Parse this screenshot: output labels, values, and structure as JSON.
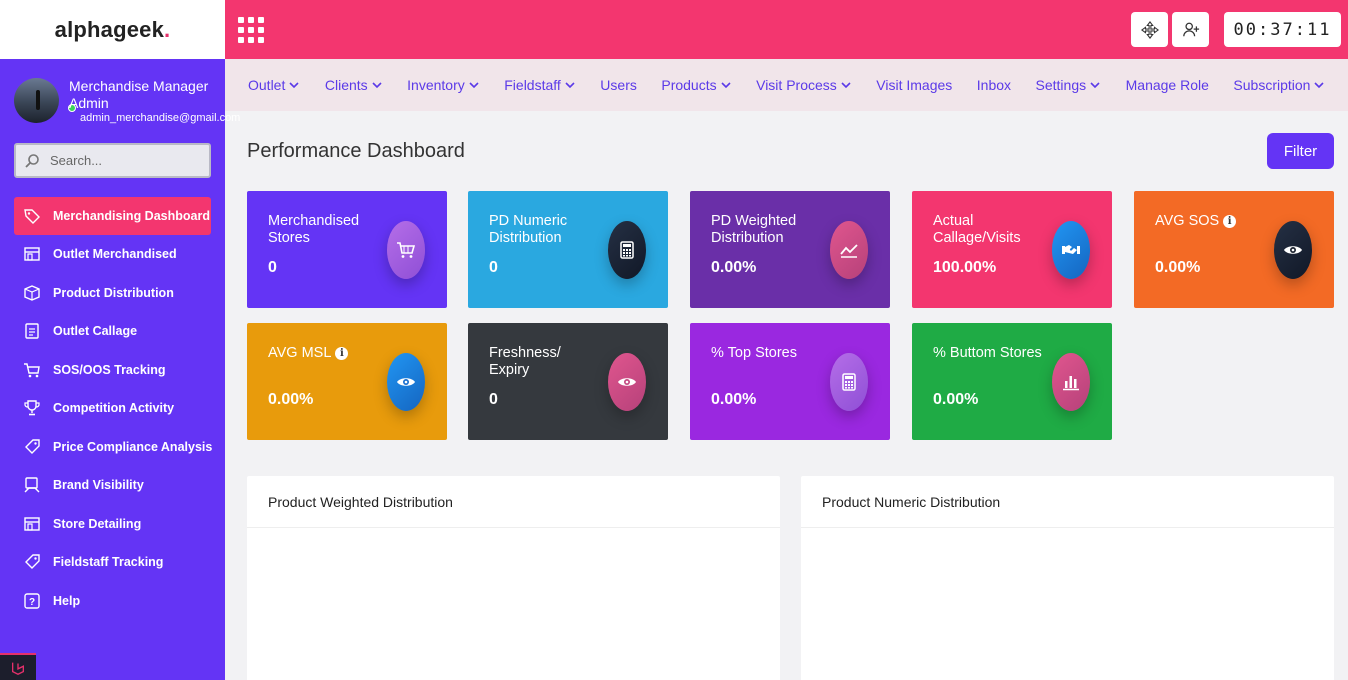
{
  "brand": {
    "logo_prefix": "alphageek",
    "logo_suffix": "."
  },
  "profile": {
    "name": "Merchandise Manager Admin",
    "email": "admin_merchandise@gmail.com"
  },
  "search": {
    "placeholder": "Search..."
  },
  "sidebar": {
    "items": [
      {
        "label": "Merchandising Dashboard",
        "icon": "tag-icon",
        "active": true
      },
      {
        "label": "Outlet Merchandised",
        "icon": "store-icon"
      },
      {
        "label": "Product Distribution",
        "icon": "box-icon"
      },
      {
        "label": "Outlet Callage",
        "icon": "clipboard-icon"
      },
      {
        "label": "SOS/OOS Tracking",
        "icon": "cart-icon"
      },
      {
        "label": "Competition Activity",
        "icon": "trophy-icon"
      },
      {
        "label": "Price Compliance Analysis",
        "icon": "price-tag-icon"
      },
      {
        "label": "Brand Visibility",
        "icon": "display-icon"
      },
      {
        "label": "Store Detailing",
        "icon": "store-icon"
      },
      {
        "label": "Fieldstaff Tracking",
        "icon": "price-tag-icon"
      },
      {
        "label": "Help",
        "icon": "help-icon"
      }
    ]
  },
  "header": {
    "clock": "00:37:11"
  },
  "subnav": {
    "items": [
      {
        "label": "Outlet",
        "dropdown": true
      },
      {
        "label": "Clients",
        "dropdown": true
      },
      {
        "label": "Inventory",
        "dropdown": true
      },
      {
        "label": "Fieldstaff",
        "dropdown": true
      },
      {
        "label": "Users",
        "dropdown": false
      },
      {
        "label": "Products",
        "dropdown": true
      },
      {
        "label": "Visit Process",
        "dropdown": true
      },
      {
        "label": "Visit Images",
        "dropdown": false
      },
      {
        "label": "Inbox",
        "dropdown": false
      },
      {
        "label": "Settings",
        "dropdown": true
      },
      {
        "label": "Manage Role",
        "dropdown": false
      },
      {
        "label": "Subscription",
        "dropdown": true
      }
    ]
  },
  "main": {
    "title": "Performance Dashboard",
    "filter_label": "Filter",
    "cards": [
      {
        "title": "Merchandised Stores",
        "value": "0",
        "bg": "#6434f5",
        "icon": "cart-icon",
        "icon_bg": "linear-gradient(135deg,#b56ee8,#8f4fd6)"
      },
      {
        "title": "PD Numeric Distribution",
        "value": "0",
        "bg": "#2aa8e0",
        "icon": "calculator-icon",
        "icon_bg": "linear-gradient(135deg,#253044,#111827)"
      },
      {
        "title": "PD Weighted Distribution",
        "value": "0.00%",
        "bg": "#6a2fa8",
        "icon": "trend-icon",
        "icon_bg": "linear-gradient(135deg,#e0568e,#b6417a)"
      },
      {
        "title": "Actual Callage/Visits",
        "value": "100.00%",
        "bg": "#f3366f",
        "icon": "handshake-icon",
        "icon_bg": "linear-gradient(135deg,#2196f3,#1565c0)"
      },
      {
        "title": "AVG SOS",
        "value": "0.00%",
        "bg": "#f36a25",
        "icon": "eye-icon",
        "icon_bg": "linear-gradient(135deg,#253044,#111827)",
        "info": true
      },
      {
        "title": "AVG MSL",
        "value": "0.00%",
        "bg": "#e89b0c",
        "icon": "eye-icon",
        "icon_bg": "linear-gradient(135deg,#2196f3,#1565c0)",
        "info": true
      },
      {
        "title": "Freshness/ Expiry",
        "value": "0",
        "bg": "#35393e",
        "icon": "eye-icon",
        "icon_bg": "linear-gradient(135deg,#e0568e,#b6417a)"
      },
      {
        "title": "% Top Stores",
        "value": "0.00%",
        "bg": "#9a28e0",
        "icon": "calculator-icon",
        "icon_bg": "linear-gradient(135deg,#b56ee8,#8f4fd6)"
      },
      {
        "title": "% Buttom Stores",
        "value": "0.00%",
        "bg": "#1fab45",
        "icon": "bar-chart-icon",
        "icon_bg": "linear-gradient(135deg,#e0568e,#b6417a)"
      }
    ],
    "panels": [
      {
        "title": "Product Weighted Distribution"
      },
      {
        "title": "Product Numeric Distribution"
      }
    ]
  }
}
